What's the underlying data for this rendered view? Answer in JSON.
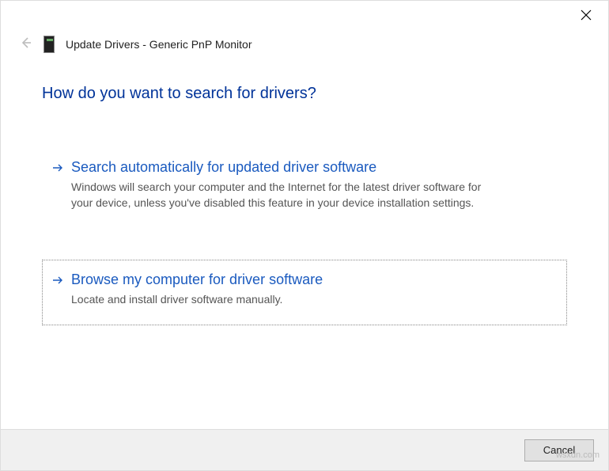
{
  "header": {
    "title": "Update Drivers - Generic PnP Monitor"
  },
  "heading": "How do you want to search for drivers?",
  "options": [
    {
      "title": "Search automatically for updated driver software",
      "desc": "Windows will search your computer and the Internet for the latest driver software for your device, unless you've disabled this feature in your device installation settings."
    },
    {
      "title": "Browse my computer for driver software",
      "desc": "Locate and install driver software manually."
    }
  ],
  "footer": {
    "cancel": "Cancel"
  },
  "watermark": "wsxdn.com"
}
